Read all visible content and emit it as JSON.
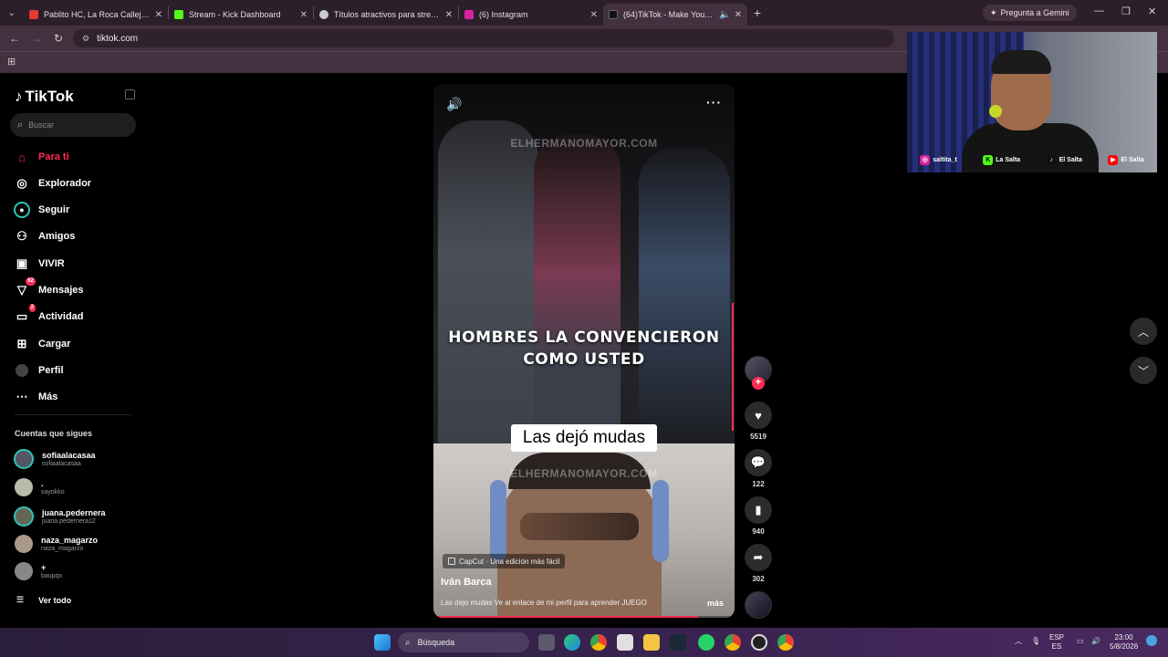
{
  "browser": {
    "tabs": [
      {
        "title": "Pablito HC, La Roca Callejera - S",
        "color": "#e53935"
      },
      {
        "title": "Stream - Kick Dashboard",
        "color": "#53fc18"
      },
      {
        "title": "Títulos atractivos para stream",
        "color": "#cccccc"
      },
      {
        "title": "(6) Instagram",
        "color": "#d6249f"
      },
      {
        "title": "(64)TikTok - Make Your Day",
        "color": "#111111"
      }
    ],
    "gemini_label": "Pregunta a Gemini",
    "url": "tiktok.com"
  },
  "tiktok": {
    "logo": "TikTok",
    "search_placeholder": "Buscar",
    "nav": [
      {
        "label": "Para ti",
        "icon": "home-icon",
        "active": true
      },
      {
        "label": "Explorador",
        "icon": "compass-icon"
      },
      {
        "label": "Seguir",
        "icon": "following-icon"
      },
      {
        "label": "Amigos",
        "icon": "friends-icon"
      },
      {
        "label": "VIVIR",
        "icon": "live-icon"
      },
      {
        "label": "Mensajes",
        "icon": "messages-icon",
        "badge": "62"
      },
      {
        "label": "Actividad",
        "icon": "activity-icon",
        "badge": "2"
      },
      {
        "label": "Cargar",
        "icon": "upload-icon"
      },
      {
        "label": "Perfil",
        "icon": "profile-icon"
      },
      {
        "label": "Más",
        "icon": "more-icon"
      }
    ],
    "following_title": "Cuentas que sigues",
    "accounts": [
      {
        "name": "sofiaalacasaa",
        "handle": "sofiaalacasaa"
      },
      {
        "name": ".",
        "handle": "sayokko"
      },
      {
        "name": "juana.pedernera",
        "handle": "juana.pedernera12"
      },
      {
        "name": "naza_magarzo",
        "handle": "naza_magarzo"
      },
      {
        "name": "+",
        "handle": "baupqx"
      }
    ],
    "see_all": "Ver todo"
  },
  "video": {
    "watermark": "ELHERMANOMAYOR.COM",
    "caption_line1": "HOMBRES LA CONVENCIERON",
    "caption_line2": "COMO USTED",
    "sticker": "Las dejó mudas",
    "capcut": "CapCut · Una edición más fácil",
    "author": "Iván Barca",
    "description": "Las dejo mudas Ve al enlace de mi perfil para aprender JUEGO",
    "more": "más",
    "progress": 0.88,
    "likes": "5519",
    "comments": "122",
    "saves": "940",
    "shares": "302"
  },
  "webcam": {
    "socials": [
      {
        "label": "saltita_t",
        "color": "#d6249f",
        "glyph": "◎"
      },
      {
        "label": "La Salta",
        "color": "#53fc18",
        "glyph": "K"
      },
      {
        "label": "El Salta",
        "color": "#111111",
        "glyph": "♪"
      },
      {
        "label": "El Salta",
        "color": "#ff0000",
        "glyph": "▶"
      }
    ]
  },
  "taskbar": {
    "search_label": "Búsqueda",
    "lang_top": "ESP",
    "lang_bottom": "ES",
    "time": "23:00",
    "date": "5/8/2026"
  }
}
